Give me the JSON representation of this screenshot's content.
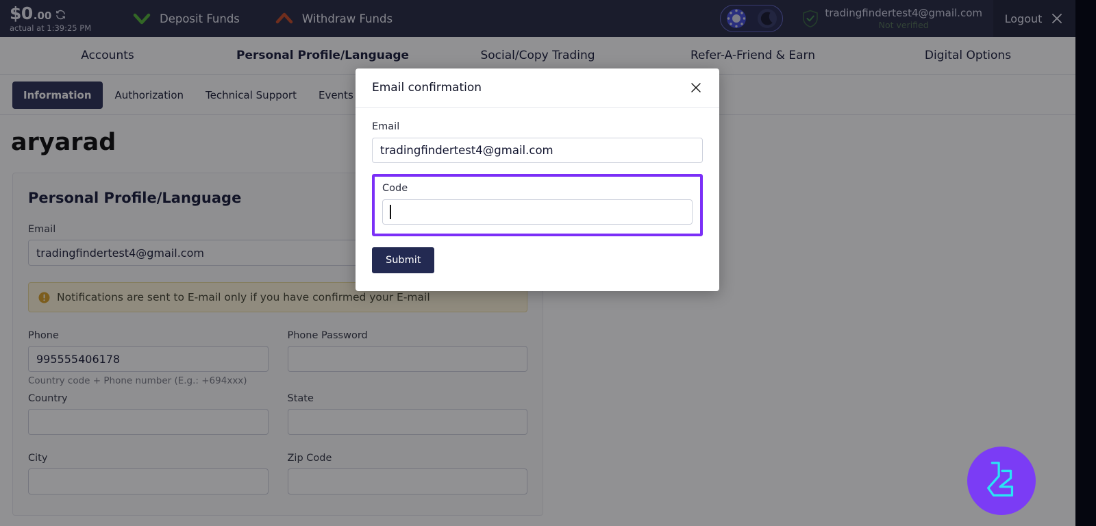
{
  "topbar": {
    "balance_currency": "$0",
    "balance_cents": ".00",
    "balance_subtitle": "actual at 1:39:25 PM",
    "refresh_icon": "refresh-icon",
    "deposit_label": "Deposit Funds",
    "deposit_icon": "chevron-down-green-icon",
    "withdraw_label": "Withdraw Funds",
    "withdraw_icon": "chevron-up-red-icon",
    "theme_light_icon": "sun-icon",
    "theme_dark_icon": "moon-icon",
    "verified_icon": "shield-check-icon",
    "account_email": "tradingfindertest4@gmail.com",
    "account_status": "Not verified",
    "logout_label": "Logout",
    "logout_icon": "close-x-icon"
  },
  "mainnav": {
    "items": [
      {
        "label": "Accounts",
        "active": false
      },
      {
        "label": "Personal Profile/Language",
        "active": true
      },
      {
        "label": "Social/Copy Trading",
        "active": false
      },
      {
        "label": "Refer-A-Friend & Earn",
        "active": false
      },
      {
        "label": "Digital Options",
        "active": false
      }
    ]
  },
  "subnav": {
    "items": [
      {
        "label": "Information",
        "active": true
      },
      {
        "label": "Authorization",
        "active": false
      },
      {
        "label": "Technical Support",
        "active": false
      },
      {
        "label": "Events Log",
        "active": false
      }
    ]
  },
  "page": {
    "username": "aryarad",
    "card_title": "Personal Profile/Language",
    "email_label": "Email",
    "email_value": "tradingfindertest4@gmail.com",
    "warning_icon": "warning-exclamation-icon",
    "warning_text": "Notifications are sent to E-mail only if you have confirmed your E-mail",
    "phone_label": "Phone",
    "phone_value": "995555406178",
    "phone_hint": "Country code + Phone number (E.g.: +694xxx)",
    "phone_password_label": "Phone Password",
    "phone_password_value": "",
    "country_label": "Country",
    "country_value": "",
    "state_label": "State",
    "state_value": "",
    "city_label": "City",
    "city_value": "",
    "zip_label": "Zip Code",
    "zip_value": ""
  },
  "modal": {
    "title": "Email confirmation",
    "close_icon": "close-x-icon",
    "email_label": "Email",
    "email_value": "tradingfindertest4@gmail.com",
    "code_label": "Code",
    "code_value": "",
    "submit_label": "Submit",
    "highlight_color": "#7b2ff7"
  },
  "chat_widget": {
    "icon": "chat-support-logo-icon",
    "background_color": "#7b3cf5",
    "glyph_color": "#2ae4f5"
  },
  "colors": {
    "topbar_bg": "#1b1f3b",
    "accent_dark": "#232a52",
    "overlay": "rgba(26,26,30,0.48)",
    "warning_bg": "#fdf4d7",
    "highlight": "#7b2ff7"
  }
}
